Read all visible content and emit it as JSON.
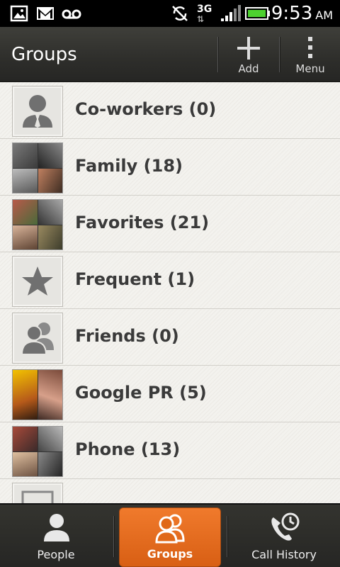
{
  "status_bar": {
    "time": "9:53",
    "ampm": "AM",
    "network": "3G",
    "icons": [
      "gallery-icon",
      "gmail-icon",
      "voicemail-icon",
      "sync-off-icon",
      "network-3g-icon",
      "signal-icon",
      "battery-icon"
    ]
  },
  "action_bar": {
    "title": "Groups",
    "add_label": "Add",
    "menu_label": "Menu"
  },
  "groups": [
    {
      "label": "Co-workers (0)",
      "icon": "person-tie-icon"
    },
    {
      "label": "Family (18)",
      "icon": "photo-collage"
    },
    {
      "label": "Favorites (21)",
      "icon": "photo-collage"
    },
    {
      "label": "Frequent (1)",
      "icon": "star-icon"
    },
    {
      "label": "Friends (0)",
      "icon": "two-people-icon"
    },
    {
      "label": "Google PR (5)",
      "icon": "photo-collage"
    },
    {
      "label": "Phone (13)",
      "icon": "photo-collage"
    },
    {
      "label": "",
      "icon": "partial-row"
    }
  ],
  "tabs": [
    {
      "label": "People",
      "icon": "person-icon",
      "active": false
    },
    {
      "label": "Groups",
      "icon": "groups-icon",
      "active": true
    },
    {
      "label": "Call History",
      "icon": "call-history-icon",
      "active": false
    }
  ],
  "colors": {
    "accent": "#e46a1e",
    "action_bar": "#2e2e2b",
    "list_bg": "#f0efeb",
    "label": "#3a3a3a"
  }
}
